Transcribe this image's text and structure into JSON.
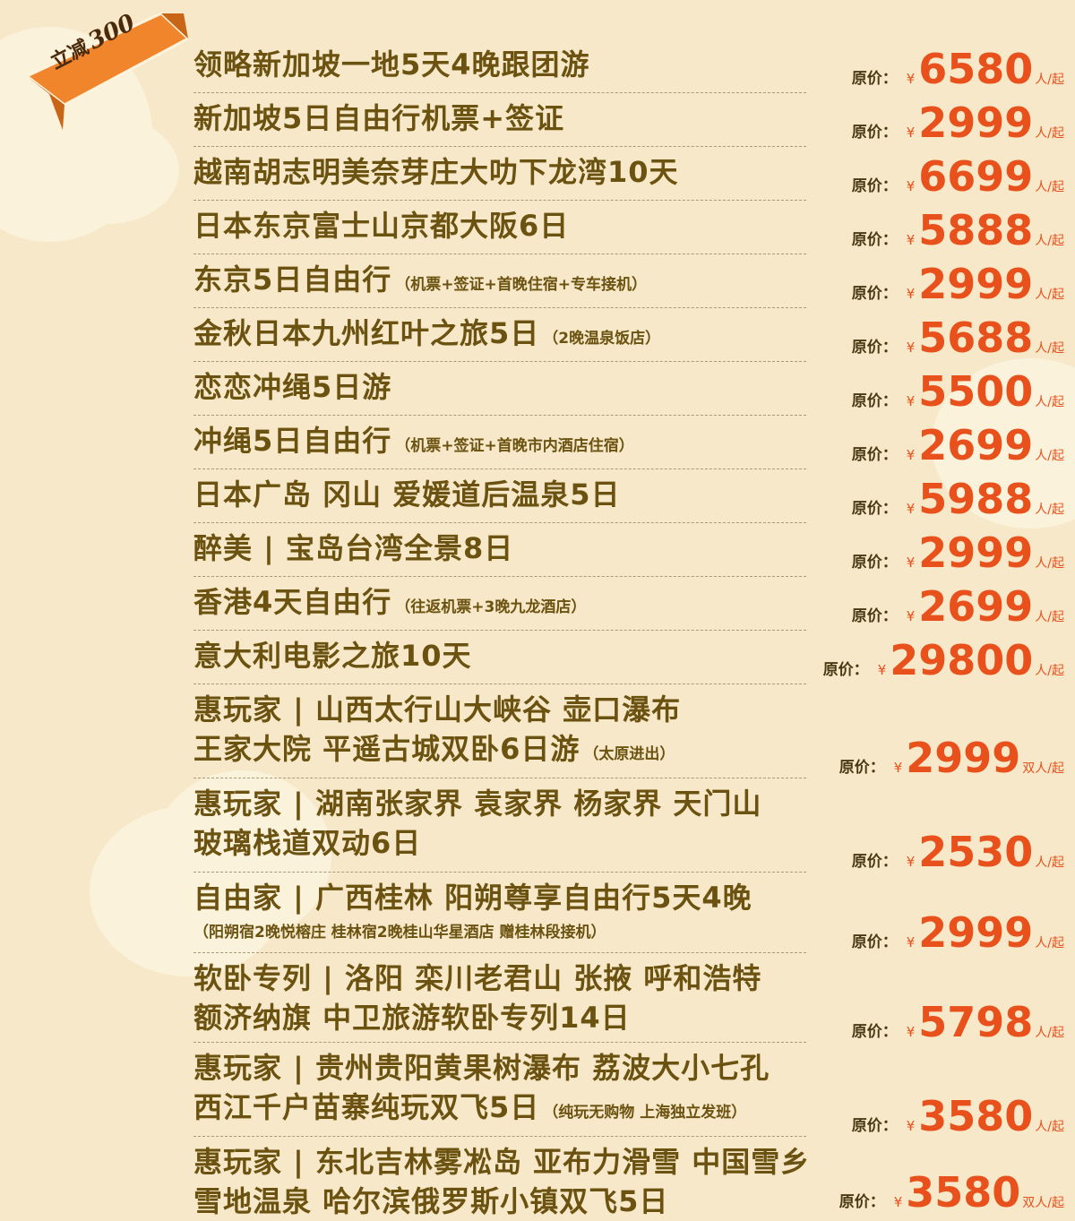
{
  "badge": {
    "label": "立减",
    "amount": "300"
  },
  "price_label": "原价：",
  "currency": "¥",
  "colors": {
    "background": "#f6e8c8",
    "title": "#6b5210",
    "price": "#e8501c",
    "badge": "#f0852c"
  },
  "items": [
    {
      "title": "领略新加坡一地5天4晚跟团游",
      "note": "",
      "price": "6580",
      "unit": "人/起"
    },
    {
      "title": "新加坡5日自由行机票+签证",
      "note": "",
      "price": "2999",
      "unit": "人/起"
    },
    {
      "title": "越南胡志明美奈芽庄大叻下龙湾10天",
      "note": "",
      "price": "6699",
      "unit": "人/起"
    },
    {
      "title": "日本东京富士山京都大阪6日",
      "note": "",
      "price": "5888",
      "unit": "人/起"
    },
    {
      "title": "东京5日自由行",
      "note": "（机票+签证+首晚住宿+专车接机）",
      "price": "2999",
      "unit": "人/起"
    },
    {
      "title": "金秋日本九州红叶之旅5日",
      "note": "（2晚温泉饭店）",
      "price": "5688",
      "unit": "人/起"
    },
    {
      "title": "恋恋冲绳5日游",
      "note": "",
      "price": "5500",
      "unit": "人/起"
    },
    {
      "title": "冲绳5日自由行",
      "note": "（机票+签证+首晚市内酒店住宿）",
      "price": "2699",
      "unit": "人/起"
    },
    {
      "title": "日本广岛 冈山 爱媛道后温泉5日",
      "note": "",
      "price": "5988",
      "unit": "人/起"
    },
    {
      "title": "醉美 | 宝岛台湾全景8日",
      "note": "",
      "price": "2999",
      "unit": "人/起"
    },
    {
      "title": "香港4天自由行",
      "note": "（往返机票+3晚九龙酒店）",
      "price": "2699",
      "unit": "人/起"
    },
    {
      "title": "意大利电影之旅10天",
      "note": "",
      "price": "29800",
      "unit": "人/起"
    },
    {
      "title": "惠玩家 | 山西太行山大峡谷 壶口瀑布",
      "title2": "王家大院 平遥古城双卧6日游",
      "note": "（太原进出）",
      "price": "2999",
      "unit": "双人/起"
    },
    {
      "title": "惠玩家 | 湖南张家界 袁家界 杨家界 天门山",
      "title2": "玻璃栈道双动6日",
      "note": "",
      "price": "2530",
      "unit": "人/起"
    },
    {
      "title": "自由家 | 广西桂林 阳朔尊享自由行5天4晚",
      "subnote": "（阳朔宿2晚悦榕庄 桂林宿2晚桂山华星酒店 赠桂林段接机）",
      "price": "2999",
      "unit": "人/起"
    },
    {
      "title": "软卧专列 | 洛阳 栾川老君山 张掖 呼和浩特",
      "title2": "额济纳旗 中卫旅游软卧专列14日",
      "note": "",
      "price": "5798",
      "unit": "人/起"
    },
    {
      "title": "惠玩家 | 贵州贵阳黄果树瀑布 荔波大小七孔",
      "title2": "西江千户苗寨纯玩双飞5日",
      "note": "（纯玩无购物 上海独立发班）",
      "price": "3580",
      "unit": "人/起"
    },
    {
      "title": "惠玩家 | 东北吉林雾凇岛 亚布力滑雪 中国雪乡",
      "title2": "雪地温泉 哈尔滨俄罗斯小镇双飞5日",
      "note": "",
      "price": "3580",
      "unit": "双人/起"
    }
  ]
}
